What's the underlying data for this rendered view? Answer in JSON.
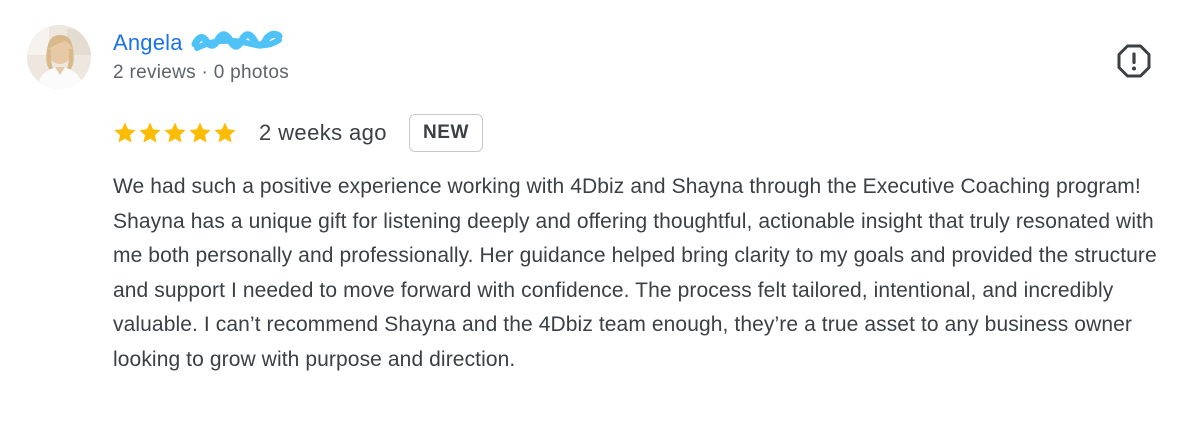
{
  "review": {
    "author": {
      "first_name": "Angela",
      "meta": "2 reviews · 0 photos"
    },
    "rating": {
      "stars": 5,
      "max_stars": 5,
      "star_color": "#fbbc04"
    },
    "time": "2 weeks ago",
    "badge": "NEW",
    "text": "We had such a positive experience working with 4Dbiz and Shayna through the Executive Coaching program! Shayna has a unique gift for listening deeply and offering thoughtful, actionable insight that truly resonated with me both personally and professionally. Her guidance helped bring clarity to my goals and provided the structure and support I needed to move forward with confidence. The process felt tailored, intentional, and incredibly valuable. I can’t recommend Shayna and the 4Dbiz team enough, they’re a true asset to any business owner looking to grow with purpose and direction.",
    "icons": {
      "avatar": "user-photo",
      "report": "report-flag-icon",
      "redaction": "redaction-scribble"
    },
    "colors": {
      "author_name": "#1a73e8",
      "redaction": "#4fc3f7",
      "text": "#3c4043",
      "meta": "#5f6368"
    }
  }
}
